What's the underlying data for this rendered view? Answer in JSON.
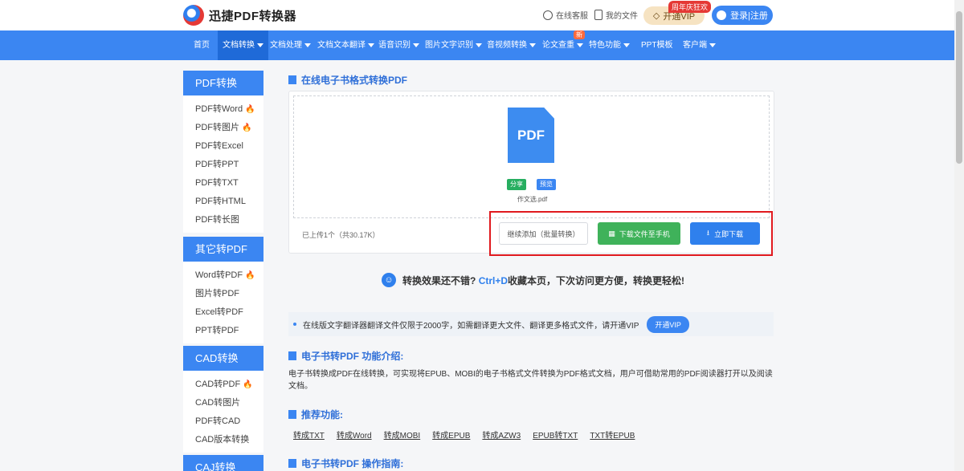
{
  "header": {
    "logo_text": "迅捷PDF转换器",
    "service_label": "在线客服",
    "files_label": "我的文件",
    "vip_label": "开通VIP",
    "vip_tag": "周年庆狂欢",
    "login_label": "登录|注册"
  },
  "nav": {
    "items": [
      "首页",
      "文档转换",
      "文档处理",
      "文档文本翻译",
      "语音识别",
      "图片文字识别",
      "音视频转换",
      "论文查重",
      "特色功能",
      "PPT模板",
      "客户端"
    ],
    "new_badge": "新"
  },
  "sidebar": {
    "groups": [
      {
        "title": "PDF转换",
        "items": [
          "PDF转Word",
          "PDF转图片",
          "PDF转Excel",
          "PDF转PPT",
          "PDF转TXT",
          "PDF转HTML",
          "PDF转长图"
        ]
      },
      {
        "title": "其它转PDF",
        "items": [
          "Word转PDF",
          "图片转PDF",
          "Excel转PDF",
          "PPT转PDF"
        ]
      },
      {
        "title": "CAD转换",
        "items": [
          "CAD转PDF",
          "CAD转图片",
          "PDF转CAD",
          "CAD版本转换"
        ]
      },
      {
        "title": "CAJ转换"
      }
    ]
  },
  "main": {
    "title": "在线电子书格式转换PDF",
    "file_icon_text": "PDF",
    "share_label": "分享",
    "preview_label": "预览",
    "file_name": "作文选.pdf",
    "upload_count": "已上传1个（共30.17K）",
    "continue_label": "继续添加（批量转换）",
    "phone_label": "下载文件至手机",
    "download_label": "立即下载",
    "bookmark_prefix": "转换效果还不错?",
    "bookmark_key": "Ctrl+D",
    "bookmark_suffix": "收藏本页，下次访问更方便，转换更轻松!",
    "notice_text": "在线版文字翻译器翻译文件仅限于2000字，如需翻译更大文件、翻译更多格式文件，请开通VIP",
    "notice_vip": "开通VIP",
    "intro_title": "电子书转PDF 功能介绍:",
    "intro_text": "电子书转换成PDF在线转换，可实现将EPUB、MOBI的电子书格式文件转换为PDF格式文档，用户可借助常用的PDF阅读器打开以及阅读文档。",
    "rec_title": "推荐功能:",
    "rec_links": [
      "转成TXT",
      "转成Word",
      "转成MOBI",
      "转成EPUB",
      "转成AZW3",
      "EPUB转TXT",
      "TXT转EPUB"
    ],
    "guide_title": "电子书转PDF 操作指南:"
  }
}
